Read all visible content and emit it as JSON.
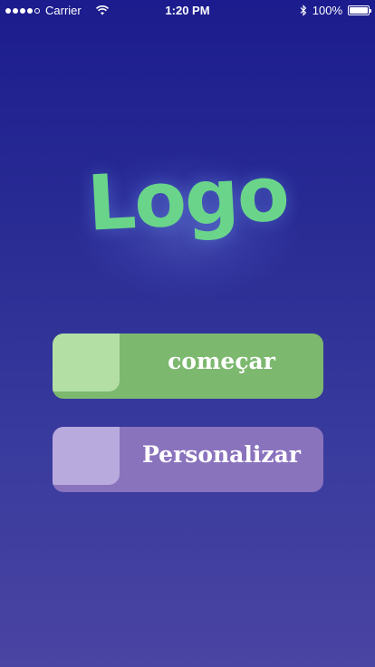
{
  "status_bar": {
    "carrier": "Carrier",
    "time": "1:20 PM",
    "battery": "100%",
    "signal_bars": 4,
    "signal_max": 5,
    "battery_level": 1.0
  },
  "logo": {
    "text": "Logo",
    "color": "#6ad58a"
  },
  "buttons": {
    "start_label": "começar",
    "start_color": "#7db86f",
    "customize_label": "Personalizar",
    "customize_color": "#8a73bd"
  }
}
